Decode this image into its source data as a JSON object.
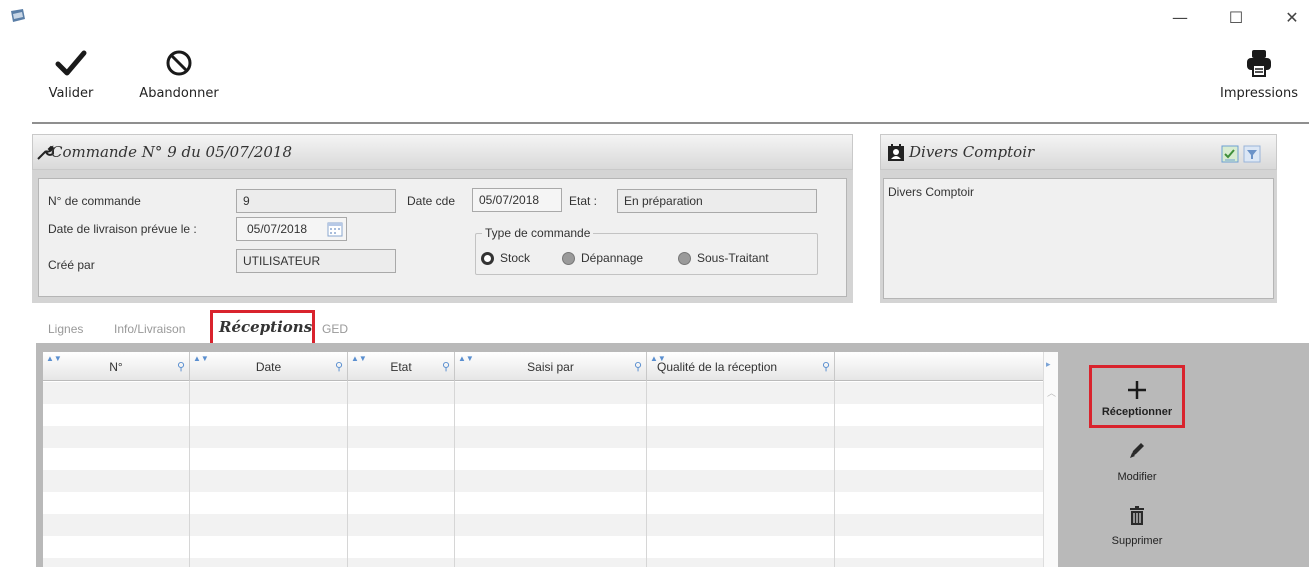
{
  "window": {
    "minimize": "—",
    "maximize": "☐",
    "close": "✕"
  },
  "toolbar": {
    "valider": "Valider",
    "abandonner": "Abandonner",
    "impressions": "Impressions"
  },
  "order_panel": {
    "title": "Commande N° 9 du 05/07/2018",
    "order_number_label": "N° de commande",
    "order_number_value": "9",
    "date_cde_label": "Date cde",
    "date_cde_value": "05/07/2018",
    "etat_label": "Etat :",
    "etat_value": "En préparation",
    "delivery_label": "Date de livraison prévue le :",
    "delivery_value": "05/07/2018",
    "created_by_label": "Créé par",
    "created_by_value": "UTILISATEUR",
    "order_type_legend": "Type de commande",
    "order_types": [
      "Stock",
      "Dépannage",
      "Sous-Traitant"
    ],
    "selected_order_type": "Stock"
  },
  "client_panel": {
    "title": "Divers Comptoir",
    "body": "Divers Comptoir"
  },
  "tabs": [
    {
      "label": "Lignes"
    },
    {
      "label": "Info/Livraison"
    },
    {
      "label": "Réceptions"
    },
    {
      "label": "GED"
    }
  ],
  "active_tab": "Réceptions",
  "grid": {
    "columns": [
      "N°",
      "Date",
      "Etat",
      "Saisi par",
      "Qualité de la réception"
    ],
    "rows": []
  },
  "actions": {
    "receptionner": "Réceptionner",
    "modifier": "Modifier",
    "supprimer": "Supprimer"
  },
  "colors": {
    "highlight": "#d9232d",
    "panel_bg": "#d4d4d4",
    "grid_frame": "#b9b9b9"
  }
}
